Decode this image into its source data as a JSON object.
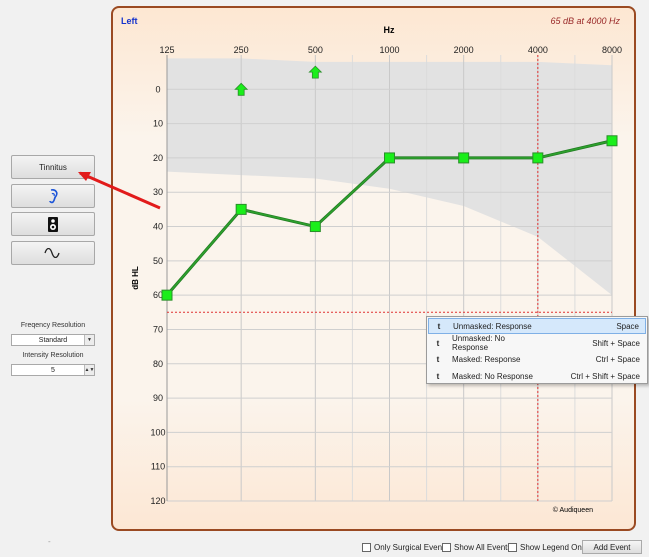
{
  "left_panel": {
    "tinnitus_label": "Tinnitus",
    "frequency_resolution_label": "Freqency Resolution",
    "frequency_resolution_value": "Standard",
    "intensity_resolution_label": "Intensity Resolution",
    "intensity_resolution_value": "5",
    "icons": [
      "ear-icon",
      "speaker-icon",
      "tone-wave-icon"
    ]
  },
  "chart": {
    "ear": "Left",
    "cursor_readout": "65 dB at 4000 Hz",
    "x_axis_title": "Hz",
    "y_axis_title": "dB HL",
    "watermark": "© Audiqueen",
    "ear_color": "#1533cc",
    "readout_color": "#9a2a2a",
    "line_color": "#2ea02e",
    "marker_color": "#1aee1a"
  },
  "chart_data": {
    "type": "line",
    "title": "",
    "xlabel": "Hz",
    "ylabel": "dB HL",
    "x_scale": "log2",
    "x_ticks": [
      125,
      250,
      500,
      1000,
      2000,
      4000,
      8000
    ],
    "x_tick_labels": [
      "125",
      "250",
      "500",
      "1000",
      "2000",
      "4000",
      "8000"
    ],
    "y_ticks": [
      0,
      10,
      20,
      30,
      40,
      50,
      60,
      70,
      80,
      90,
      100,
      110,
      120
    ],
    "y_tick_labels": [
      "0",
      "10",
      "20",
      "30",
      "40",
      "50",
      "60",
      "70",
      "80",
      "90",
      "100",
      "110",
      "120"
    ],
    "ylim": [
      -10,
      120
    ],
    "y_inverted": true,
    "grid": true,
    "series": [
      {
        "x": [
          125,
          250,
          500,
          1000,
          2000,
          4000,
          8000
        ],
        "y": [
          60,
          35,
          40,
          20,
          20,
          20,
          15
        ]
      }
    ],
    "no_response_markers": [
      {
        "x": 250,
        "y": 0
      },
      {
        "x": 500,
        "y": -5
      }
    ],
    "shaded_band": {
      "x": [
        125,
        250,
        500,
        1000,
        2000,
        4000,
        8000
      ],
      "upper": [
        -9,
        -9,
        -8,
        -8,
        -8,
        -8,
        -7
      ],
      "lower": [
        24,
        25,
        26,
        29,
        34,
        43,
        60
      ]
    },
    "cursor": {
      "x": 4000,
      "y": 65
    }
  },
  "context_menu": {
    "items": [
      {
        "key": "t",
        "label": "Unmasked: Response",
        "shortcut": "Space"
      },
      {
        "key": "t",
        "label": "Unmasked: No Response",
        "shortcut": "Shift + Space"
      },
      {
        "key": "t",
        "label": "Masked: Response",
        "shortcut": "Ctrl + Space"
      },
      {
        "key": "t",
        "label": "Masked: No Response",
        "shortcut": "Ctrl + Shift + Space"
      }
    ]
  },
  "bottom_bar": {
    "only_surgical_events": "Only Surgical Events",
    "show_all_events": "Show All Events",
    "show_legend_only": "Show Legend Only",
    "add_event": "Add Event"
  },
  "annotation_color": "#e21b1b"
}
